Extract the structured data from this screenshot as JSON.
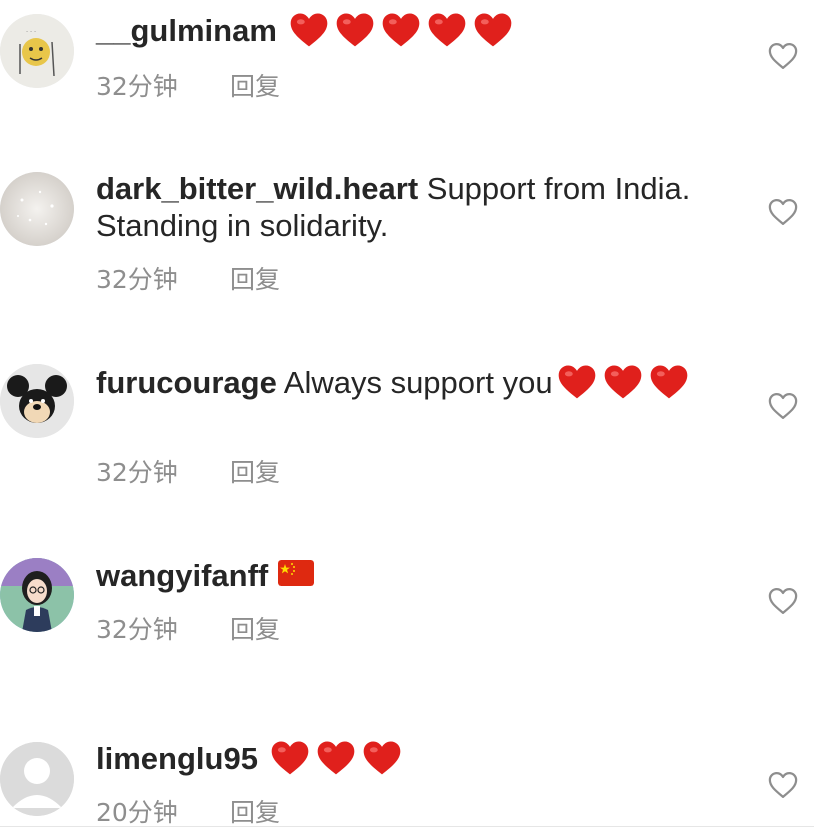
{
  "comments": [
    {
      "username": "__gulminam",
      "text": "",
      "hearts": 5,
      "time": "32分钟",
      "reply_label": "回复",
      "avatar_icon": "sketch-avatar"
    },
    {
      "username": "dark_bitter_wild.heart",
      "text": " Support from India. Standing in solidarity.",
      "time": "32分钟",
      "reply_label": "回复",
      "avatar_icon": "sparkle-avatar"
    },
    {
      "username": "furucourage",
      "text": " Always support you",
      "hearts": 3,
      "time": "32分钟",
      "reply_label": "回复",
      "avatar_icon": "mouse-plush-avatar"
    },
    {
      "username": "wangyifanff",
      "text": "",
      "flag": "china-flag",
      "time": "32分钟",
      "reply_label": "回复",
      "avatar_icon": "cartoon-girl-avatar"
    },
    {
      "username": "limenglu95",
      "text": "",
      "hearts": 3,
      "time": "20分钟",
      "reply_label": "回复",
      "avatar_icon": "default-avatar"
    }
  ],
  "colors": {
    "username": "#262626",
    "meta": "#8e8e8e",
    "heart_emoji": "#e0201c",
    "like_outline": "#8e8e8e",
    "flag_red": "#de2910",
    "flag_star": "#ffde00"
  }
}
